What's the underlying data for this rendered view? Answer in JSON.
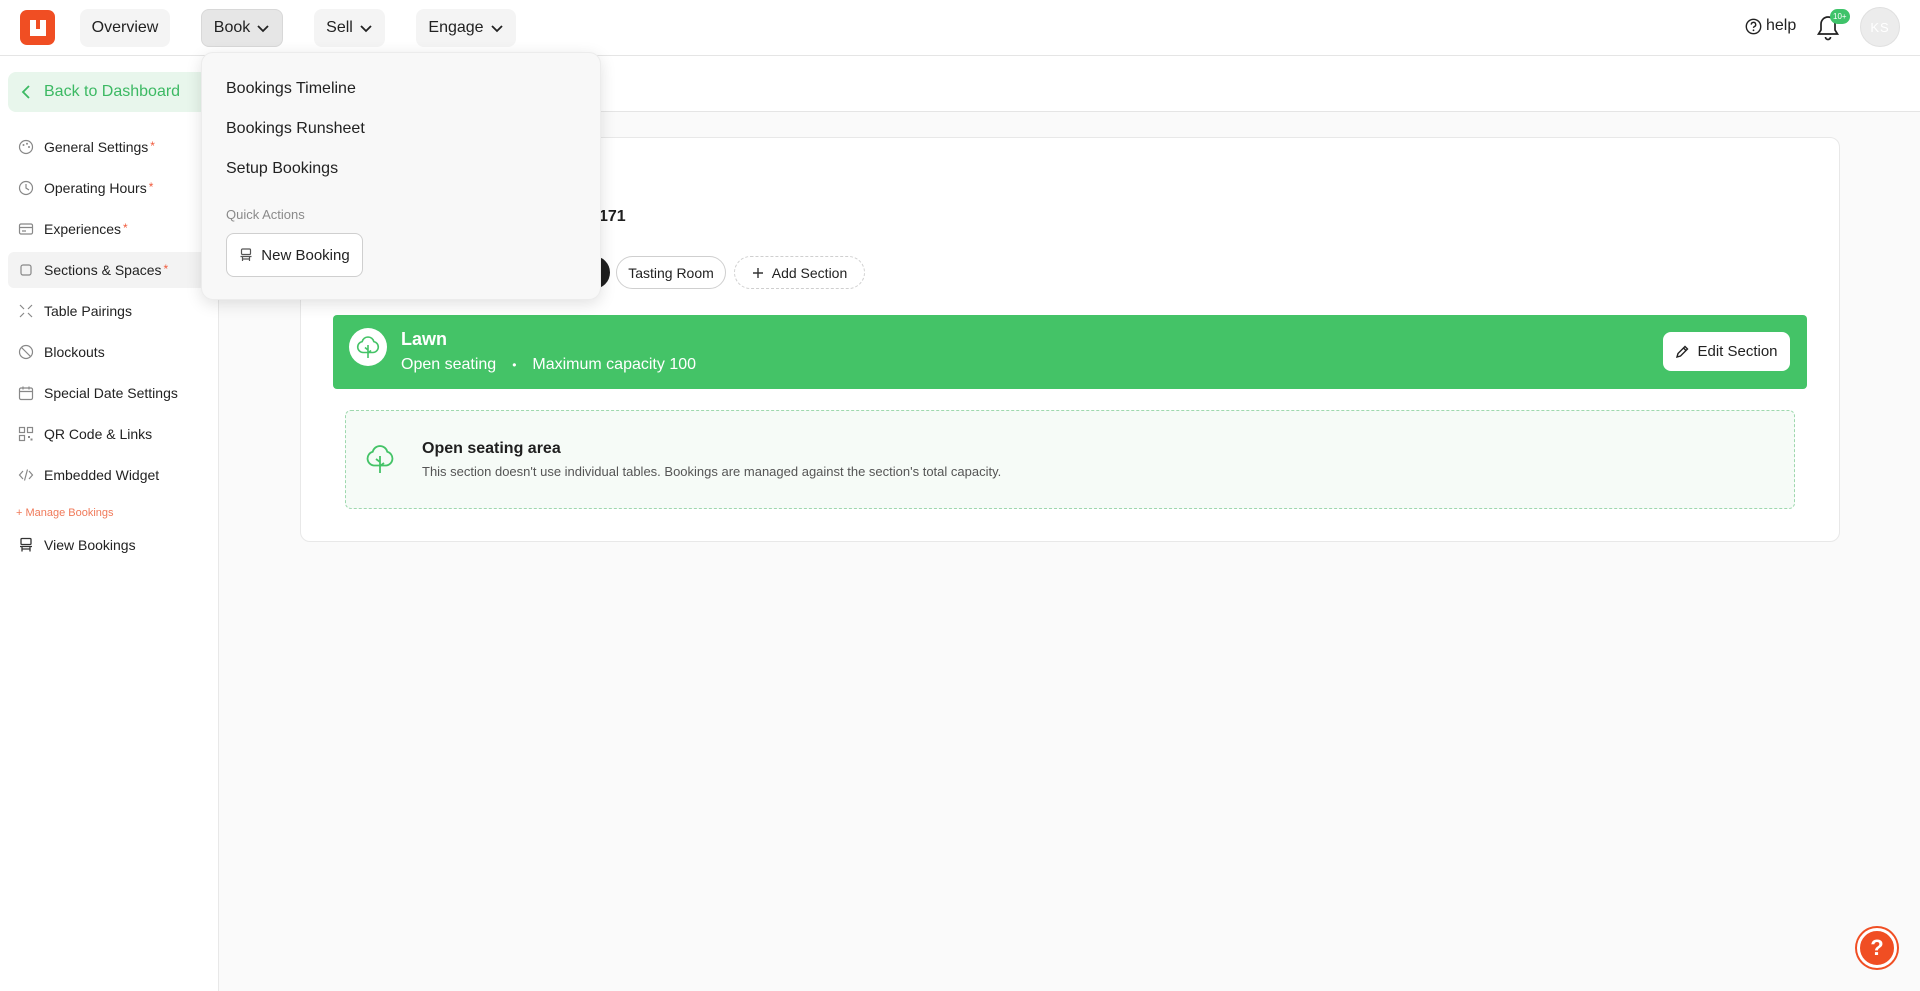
{
  "topbar": {
    "nav": [
      "Overview",
      "Book",
      "Sell",
      "Engage"
    ],
    "help_label": "help",
    "notif_badge": "10+",
    "avatar_initials": "KS"
  },
  "sidebar": {
    "back_label": "Back to Dashboard",
    "items": [
      {
        "label": "General Settings",
        "required": true,
        "icon": "palette-icon"
      },
      {
        "label": "Operating Hours",
        "required": true,
        "icon": "clock-icon"
      },
      {
        "label": "Experiences",
        "required": true,
        "icon": "card-icon"
      },
      {
        "label": "Sections & Spaces",
        "required": true,
        "icon": "square-icon"
      },
      {
        "label": "Table Pairings",
        "required": false,
        "icon": "pairing-icon"
      },
      {
        "label": "Blockouts",
        "required": false,
        "icon": "ban-icon"
      },
      {
        "label": "Special Date Settings",
        "required": false,
        "icon": "calendar-icon"
      },
      {
        "label": "QR Code & Links",
        "required": false,
        "icon": "qr-icon"
      },
      {
        "label": "Embedded Widget",
        "required": false,
        "icon": "code-icon"
      }
    ],
    "required_marker": "*",
    "manage_section": "+ Manage Bookings",
    "view_bookings": "View Bookings"
  },
  "main": {
    "partial_number": "171",
    "section_tabs": [
      "Tasting Room"
    ],
    "add_section": "Add Section",
    "lawn": {
      "title": "Lawn",
      "seating": "Open seating",
      "separator": "•",
      "capacity": "Maximum capacity 100",
      "edit_label": "Edit Section"
    },
    "open_area": {
      "title": "Open seating area",
      "description": "This section doesn't use individual tables. Bookings are managed against the section's total capacity."
    }
  },
  "dropdown": {
    "items": [
      "Bookings Timeline",
      "Bookings Runsheet",
      "Setup Bookings"
    ],
    "quick_actions_label": "Quick Actions",
    "new_booking_label": "New Booking"
  },
  "fab": {
    "label": "?"
  },
  "colors": {
    "brand": "#f04e23",
    "green": "#44c367",
    "required": "#f05a3c"
  }
}
